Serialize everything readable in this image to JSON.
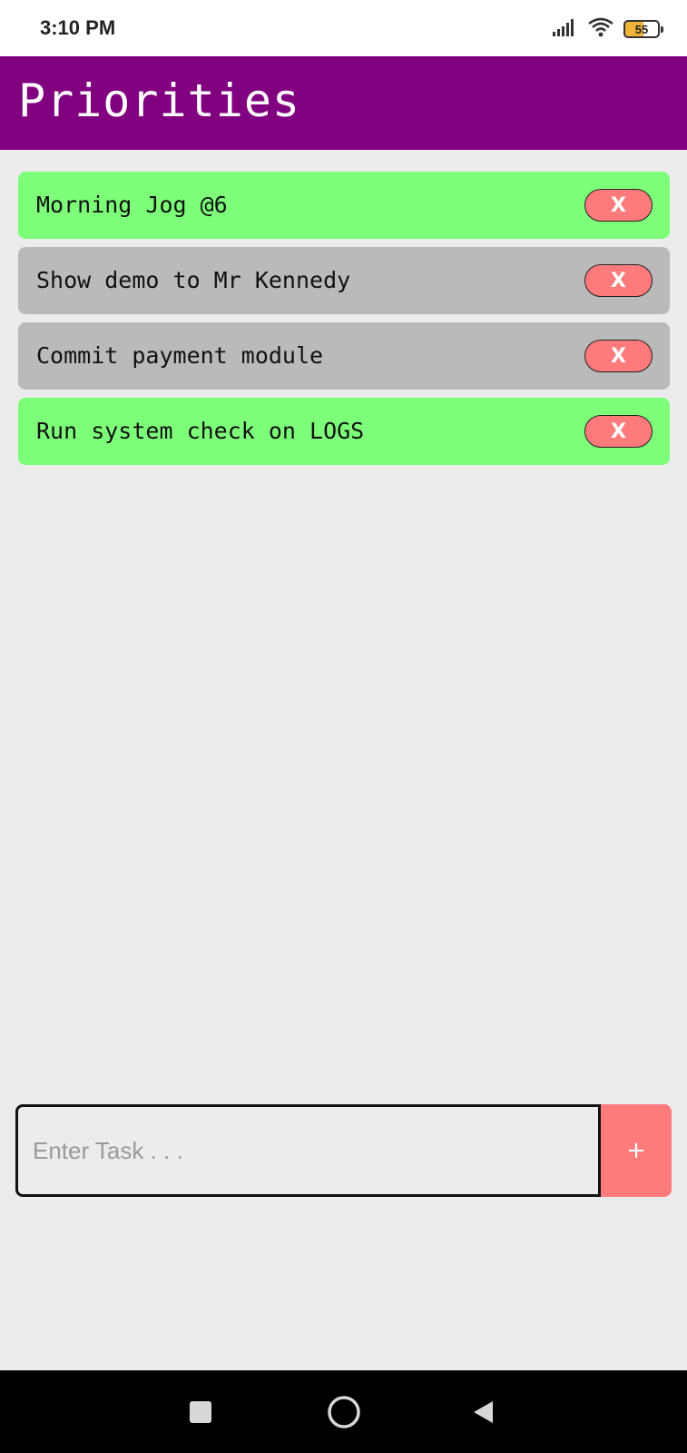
{
  "status_bar": {
    "time": "3:10 PM",
    "battery_level": "55",
    "icons": [
      "signal-icon",
      "wifi-icon",
      "battery-icon"
    ]
  },
  "header": {
    "title": "Priorities",
    "background_color": "#800080"
  },
  "tasks": [
    {
      "text": "Morning Jog @6",
      "color": "#7dff7a",
      "delete_label": "X"
    },
    {
      "text": "Show demo to Mr Kennedy",
      "color": "#bababa",
      "delete_label": "X"
    },
    {
      "text": "Commit payment module",
      "color": "#bababa",
      "delete_label": "X"
    },
    {
      "text": "Run system check on LOGS",
      "color": "#7dff7a",
      "delete_label": "X"
    }
  ],
  "input": {
    "placeholder": "Enter Task . . .",
    "value": "",
    "add_label": "+"
  },
  "colors": {
    "accent": "#ff7b7b",
    "background": "#ececec"
  },
  "nav_bar": {
    "buttons": [
      "recents-square-icon",
      "home-circle-icon",
      "back-triangle-icon"
    ]
  }
}
